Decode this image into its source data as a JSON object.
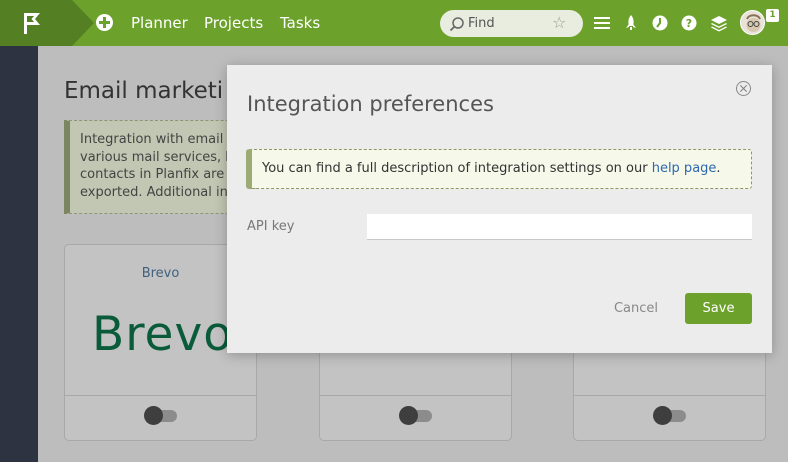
{
  "topbar": {
    "nav": [
      "Planner",
      "Projects",
      "Tasks"
    ],
    "search_placeholder": "Find",
    "notification_count": "1",
    "icons": [
      "logo-flag-icon",
      "add-icon",
      "search-icon",
      "star-icon",
      "menu-icon",
      "rocket-icon",
      "activity-icon",
      "help-icon",
      "layers-icon",
      "avatar"
    ],
    "colors": {
      "bar": "#6ca22c",
      "logo_block": "#547f22"
    }
  },
  "background_page": {
    "title": "Email marketi",
    "info_lines": [
      "Integration with email m",
      "various mail services, b",
      "contacts in Planfix are a",
      "exported. Additional inf"
    ],
    "cards": [
      {
        "title": "Brevo",
        "logo_text": "Brevo",
        "enabled": false
      },
      {
        "title": "",
        "logo_text": "",
        "enabled": false
      },
      {
        "title": "",
        "logo_text": "",
        "enabled": false
      }
    ]
  },
  "modal": {
    "title": "Integration preferences",
    "notice_prefix": "You can find a full description of integration settings on our ",
    "notice_link": "help page",
    "notice_suffix": ".",
    "api_key_label": "API key",
    "api_key_value": "",
    "cancel_label": "Cancel",
    "save_label": "Save"
  }
}
